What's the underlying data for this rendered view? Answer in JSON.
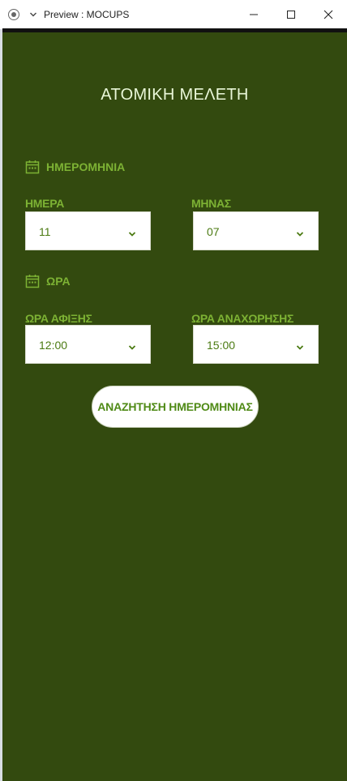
{
  "window": {
    "title": "Preview : MOCUPS"
  },
  "page": {
    "title": "ΑΤΟΜΙΚΗ ΜΕΛΕΤΗ"
  },
  "date_section": {
    "heading": "ΗΜΕΡΟΜΗΝΙΑ",
    "icon": "calendar-icon",
    "day": {
      "label": "ΗΜΕΡΑ",
      "value": "11"
    },
    "month": {
      "label": "ΜΗΝΑΣ",
      "value": "07"
    }
  },
  "time_section": {
    "heading": "ΩΡΑ",
    "icon": "calendar-icon",
    "arrival": {
      "label": "ΩΡΑ ΑΦΙΞΗΣ",
      "value": "12:00"
    },
    "departure": {
      "label": "ΩΡΑ ΑΝΑΧΩΡΗΣΗΣ",
      "value": "15:00"
    }
  },
  "actions": {
    "search_label": "ΑΝΑΖΗΤΗΣΗ ΗΜΕΡΟΜΗΝΙΑΣ"
  },
  "colors": {
    "background": "#334a0f",
    "accent": "#7db234",
    "title_text": "#e9f7d8"
  }
}
